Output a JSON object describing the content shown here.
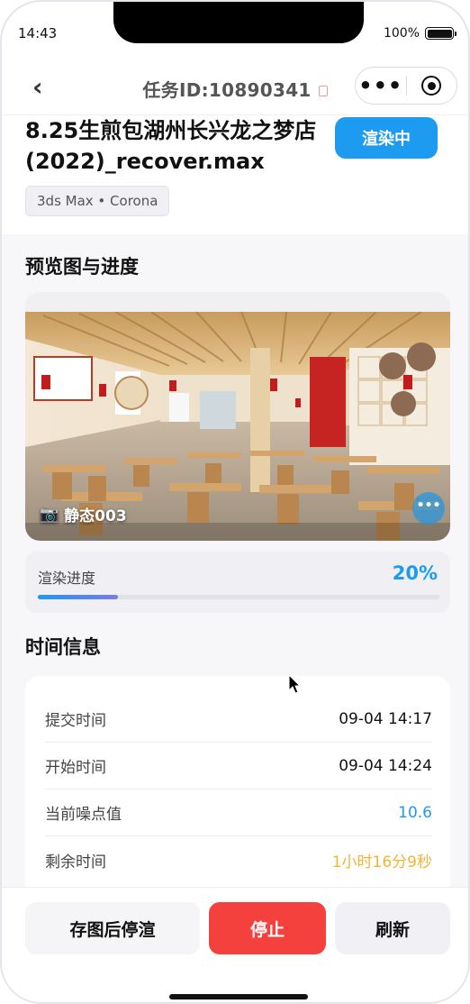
{
  "status_bar": {
    "time": "14:43",
    "battery": "100%"
  },
  "nav": {
    "back_icon": "chevron-left-icon",
    "title": "任务ID:10890341",
    "copy_icon": "copy-icon",
    "more_icon": "more-dots-icon",
    "close_icon": "target-icon"
  },
  "task": {
    "name": "8.25生煎包湖州长兴龙之梦店(2022)_recover.max",
    "status": "渲染中",
    "status_color": "#1d9bf0",
    "engine": "3ds Max • Corona"
  },
  "preview": {
    "section_title": "预览图与进度",
    "camera_icon": "camera-icon",
    "camera_label": "静态003",
    "chat_icon": "chat-bubble-icon",
    "progress_label": "渲染进度",
    "progress_value": "20%",
    "progress_fraction": 0.2
  },
  "time_info": {
    "section_title": "时间信息",
    "rows": [
      {
        "key": "提交时间",
        "value": "09-04 14:17",
        "color": "#111111"
      },
      {
        "key": "开始时间",
        "value": "09-04 14:24",
        "color": "#111111"
      },
      {
        "key": "当前噪点值",
        "value": "10.6",
        "color": "#1d9bf0"
      },
      {
        "key": "剩余时间",
        "value": "1小时16分9秒",
        "color": "#f2b431"
      }
    ]
  },
  "actions": {
    "save_then_stop": "存图后停渲",
    "stop": "停止",
    "refresh": "刷新"
  }
}
